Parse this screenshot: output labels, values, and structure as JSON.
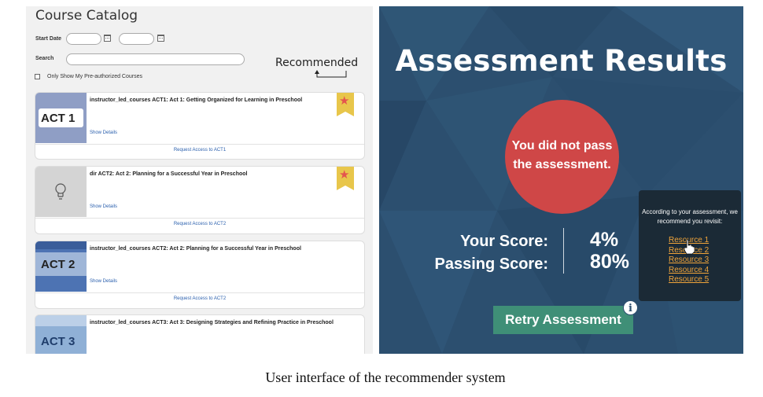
{
  "catalog": {
    "title": "Course Catalog",
    "start_date_label": "Start Date",
    "search_label": "Search",
    "search_placeholder": "",
    "preauth_label": "Only Show My Pre-authorized Courses",
    "recommended_annotation": "Recommended",
    "courses": [
      {
        "thumb_text": "ACT 1",
        "title": "instructor_led_courses ACT1: Act 1: Getting Organized for Learning in Preschool",
        "details": "Show Details",
        "request": "Request Access to ACT1",
        "recommended": true
      },
      {
        "thumb_text": "",
        "title": "dir ACT2: Act 2: Planning for a Successful Year in Preschool",
        "details": "Show Details",
        "request": "Request Access to ACT2",
        "recommended": true
      },
      {
        "thumb_text": "ACT 2",
        "title": "instructor_led_courses ACT2: Act 2: Planning for a Successful Year in Preschool",
        "details": "Show Details",
        "request": "Request Access to ACT2",
        "recommended": false
      },
      {
        "thumb_text": "ACT 3",
        "title": "instructor_led_courses ACT3: Act 3: Designing Strategies and Refining Practice in Preschool",
        "details": "",
        "request": "",
        "recommended": false
      }
    ]
  },
  "results": {
    "title": "Assessment Results",
    "fail_message": "You did not pass the assessment.",
    "your_score_label": "Your Score:",
    "your_score_value": "4%",
    "passing_score_label": "Passing Score:",
    "passing_score_value": "80%",
    "retry_label": "Retry Assessment",
    "info_glyph": "i",
    "recommendation_intro": "According to your assessment, we recommend you revisit:",
    "resources": [
      "Resource 1",
      "Resource 2",
      "Resource 3",
      "Resource 4",
      "Resource 5"
    ]
  },
  "caption": "User interface of the recommender system",
  "colors": {
    "results_bg": "#2c4f6f",
    "fail_circle": "#cf4747",
    "retry_button": "#3f8f77",
    "resource_link": "#f0a43a",
    "ribbon": "#e8c64b",
    "ribbon_star": "#e4554e",
    "link_blue": "#2a5fad"
  }
}
